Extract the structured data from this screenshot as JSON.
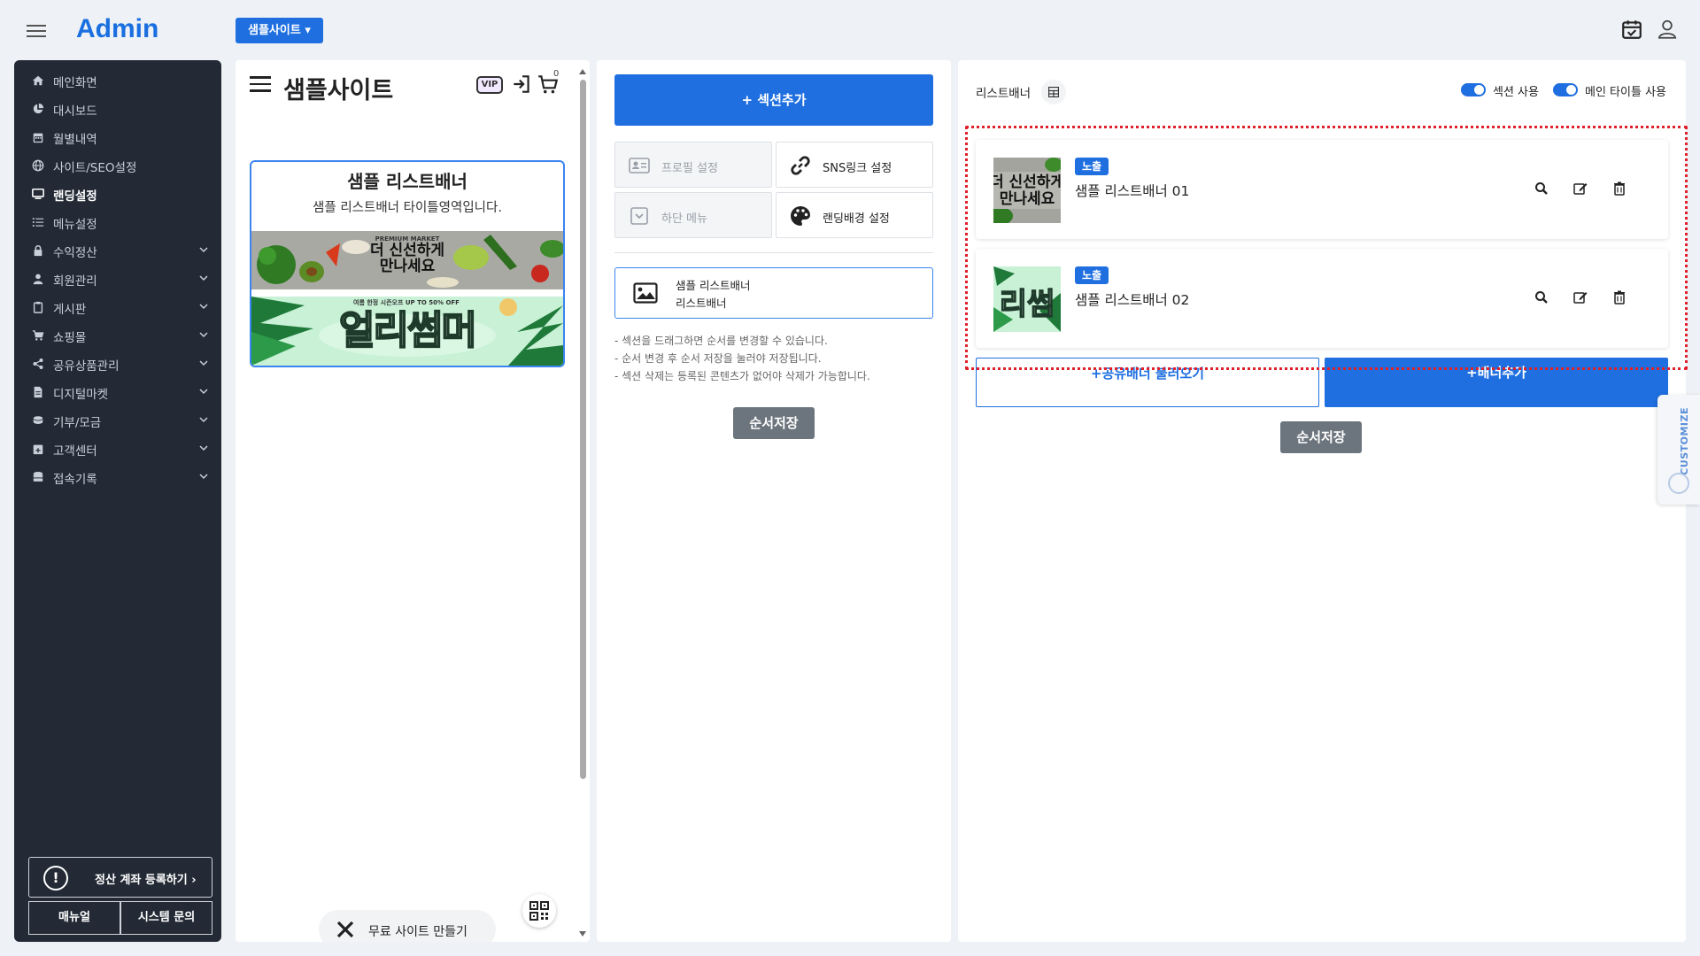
{
  "header": {
    "logo": "Admin",
    "site_select": "샘플사이트 ▾"
  },
  "sidebar": {
    "items": [
      {
        "label": "메인화면",
        "icon": "home-icon"
      },
      {
        "label": "대시보드",
        "icon": "chart-pie-icon"
      },
      {
        "label": "월별내역",
        "icon": "calendar-icon"
      },
      {
        "label": "사이트/SEO설정",
        "icon": "globe-icon"
      },
      {
        "label": "랜딩설정",
        "icon": "monitor-icon",
        "active": true
      },
      {
        "label": "메뉴설정",
        "icon": "list-icon"
      },
      {
        "label": "수익정산",
        "icon": "lock-icon",
        "has_children": true
      },
      {
        "label": "회원관리",
        "icon": "user-icon",
        "has_children": true
      },
      {
        "label": "게시판",
        "icon": "clipboard-icon",
        "has_children": true
      },
      {
        "label": "쇼핑몰",
        "icon": "cart-icon",
        "has_children": true
      },
      {
        "label": "공유상품관리",
        "icon": "share-icon",
        "has_children": true
      },
      {
        "label": "디지털마켓",
        "icon": "file-icon",
        "has_children": true
      },
      {
        "label": "기부/모금",
        "icon": "coins-icon",
        "has_children": true
      },
      {
        "label": "고객센터",
        "icon": "calendar-plus-icon",
        "has_children": true
      },
      {
        "label": "접속기록",
        "icon": "database-icon",
        "has_children": true
      }
    ],
    "register_account": "정산 계좌 등록하기 ›",
    "manual": "매뉴얼",
    "system_inquiry": "시스템 문의"
  },
  "preview": {
    "site_title": "샘플사이트",
    "vip": "VIP",
    "cart_count": "0",
    "banner_title": "샘플 리스트배너",
    "banner_subtitle": "샘플 리스트배너 타이틀영역입니다.",
    "image1_text": "더 신선하게\n만나세요",
    "image1_small": "PREMIUM MARKET",
    "image2_text": "얼리썸머",
    "image2_small": "여름 한정 시즌오프 UP TO 50% OFF",
    "free_site": "무료 사이트 만들기"
  },
  "sections": {
    "add_section": "+ 섹션추가",
    "options": [
      {
        "label": "프로필 설정",
        "icon": "id-card-icon",
        "disabled": true
      },
      {
        "label": "SNS링크 설정",
        "icon": "link-icon",
        "disabled": false
      },
      {
        "label": "하단 메뉴",
        "icon": "dropdown-box-icon",
        "disabled": true
      },
      {
        "label": "랜딩배경 설정",
        "icon": "palette-icon",
        "disabled": false
      }
    ],
    "item_line1": "샘플 리스트배너",
    "item_line2": "리스트배너",
    "notes": [
      "- 섹션을 드래그하면 순서를 변경할 수 있습니다.",
      "- 순서 변경 후 순서 저장을 눌러야 저장됩니다.",
      "- 섹션 삭제는 등록된 콘텐츠가 없어야 삭제가 가능합니다."
    ],
    "save_order": "순서저장"
  },
  "right_panel": {
    "title": "리스트배너",
    "toggle_section": "섹션 사용",
    "toggle_main_title": "메인 타이틀 사용",
    "banners": [
      {
        "badge": "노출",
        "name": "샘플 리스트배너 01"
      },
      {
        "badge": "노출",
        "name": "샘플 리스트배너 02"
      }
    ],
    "load_shared": "+공유배너 불러오기",
    "add_banner": "+배너추가",
    "save_order": "순서저장"
  },
  "customize": "CUSTOMIZE",
  "colors": {
    "primary": "#1f6fe0",
    "sidebar_bg": "#232a35",
    "highlight": "#e0202a",
    "secondary_btn": "#6c757d"
  }
}
